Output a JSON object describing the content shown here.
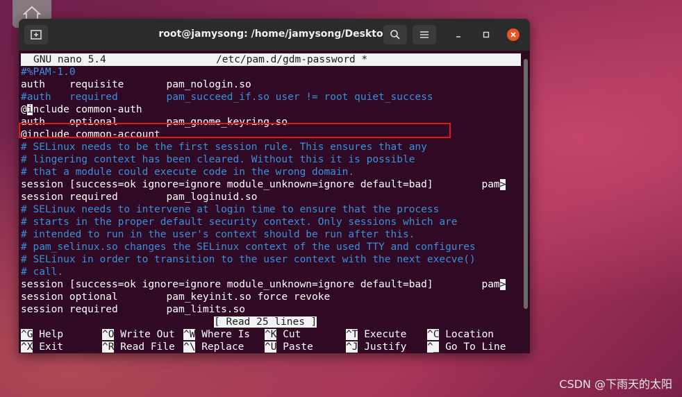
{
  "window": {
    "title": "root@jamysong: /home/jamysong/Desktop"
  },
  "nano": {
    "version": "GNU nano 5.4",
    "filename": "/etc/pam.d/gdm-password *",
    "status": "[ Read 25 lines ]"
  },
  "lines": [
    {
      "text": "#%PAM-1.0",
      "comment": true
    },
    {
      "text": "auth    requisite       pam_nologin.so",
      "comment": false
    },
    {
      "text": "#auth   required        pam_succeed_if.so user != root quiet_success",
      "comment": true,
      "highlighted": true
    },
    {
      "pre": "@",
      "cursor": "i",
      "text": "nclude common-auth",
      "comment": false
    },
    {
      "text": "auth    optional        pam_gnome_keyring.so",
      "comment": false
    },
    {
      "text": "@include common-account",
      "comment": false
    },
    {
      "text": "# SELinux needs to be the first session rule. This ensures that any",
      "comment": true
    },
    {
      "text": "# lingering context has been cleared. Without this it is possible",
      "comment": true
    },
    {
      "text": "# that a module could execute code in the wrong domain.",
      "comment": true
    },
    {
      "text": "session [success=ok ignore=ignore module_unknown=ignore default=bad]        pam",
      "comment": false,
      "overflow": true
    },
    {
      "text": "session required        pam_loginuid.so",
      "comment": false
    },
    {
      "text": "# SELinux needs to intervene at login time to ensure that the process",
      "comment": true
    },
    {
      "text": "# starts in the proper default security context. Only sessions which are",
      "comment": true
    },
    {
      "text": "# intended to run in the user's context should be run after this.",
      "comment": true
    },
    {
      "text": "# pam_selinux.so changes the SELinux context of the used TTY and configures",
      "comment": true
    },
    {
      "text": "# SELinux in order to transition to the user context with the next execve()",
      "comment": true
    },
    {
      "text": "# call.",
      "comment": true
    },
    {
      "text": "session [success=ok ignore=ignore module_unknown=ignore default=bad]        pam",
      "comment": false,
      "overflow": true
    },
    {
      "text": "session optional        pam_keyinit.so force revoke",
      "comment": false
    },
    {
      "text": "session required        pam_limits.so",
      "comment": false
    }
  ],
  "shortcuts_row1": [
    {
      "key": "^G",
      "label": "Help"
    },
    {
      "key": "^O",
      "label": "Write Out"
    },
    {
      "key": "^W",
      "label": "Where Is"
    },
    {
      "key": "^K",
      "label": "Cut"
    },
    {
      "key": "^T",
      "label": "Execute"
    },
    {
      "key": "^C",
      "label": "Location"
    }
  ],
  "shortcuts_row2": [
    {
      "key": "^X",
      "label": "Exit"
    },
    {
      "key": "^R",
      "label": "Read File"
    },
    {
      "key": "^\\",
      "label": "Replace"
    },
    {
      "key": "^U",
      "label": "Paste"
    },
    {
      "key": "^J",
      "label": "Justify"
    },
    {
      "key": "^_",
      "label": "Go To Line"
    }
  ],
  "overflow_marker": ">",
  "watermark": "CSDN @下雨天的太阳",
  "colors": {
    "terminal_bg": "#300a24",
    "comment": "#3b8fd8",
    "highlight_box": "#e01818",
    "close_button": "#e95420"
  }
}
